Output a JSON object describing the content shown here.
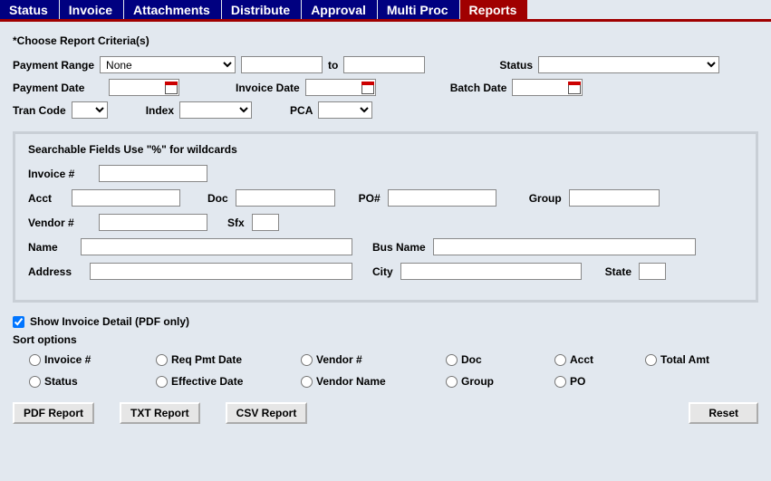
{
  "tabs": [
    "Status",
    "Invoice",
    "Attachments",
    "Distribute",
    "Approval",
    "Multi Proc",
    "Reports"
  ],
  "active_tab": 6,
  "criteria_header": "*Choose Report Criteria(s)",
  "labels": {
    "payment_range": "Payment Range",
    "to": "to",
    "status": "Status",
    "payment_date": "Payment Date",
    "invoice_date": "Invoice Date",
    "batch_date": "Batch Date",
    "tran_code": "Tran Code",
    "index": "Index",
    "pca": "PCA"
  },
  "payment_range_selected": "None",
  "fieldset": {
    "legend": "Searchable Fields  Use \"%\" for wildcards",
    "invoice_no": "Invoice #",
    "acct": "Acct",
    "doc": "Doc",
    "po_no": "PO#",
    "group": "Group",
    "vendor_no": "Vendor #",
    "sfx": "Sfx",
    "name": "Name",
    "bus_name": "Bus Name",
    "address": "Address",
    "city": "City",
    "state": "State"
  },
  "show_detail": {
    "label": "Show Invoice Detail (PDF only)",
    "checked": true
  },
  "sort_header": "Sort options",
  "sort_options": [
    "Invoice #",
    "Req Pmt Date",
    "Vendor #",
    "Doc",
    "Acct",
    "Total Amt",
    "Status",
    "Effective Date",
    "Vendor Name",
    "Group",
    "PO"
  ],
  "buttons": {
    "pdf": "PDF Report",
    "txt": "TXT Report",
    "csv": "CSV Report",
    "reset": "Reset"
  }
}
